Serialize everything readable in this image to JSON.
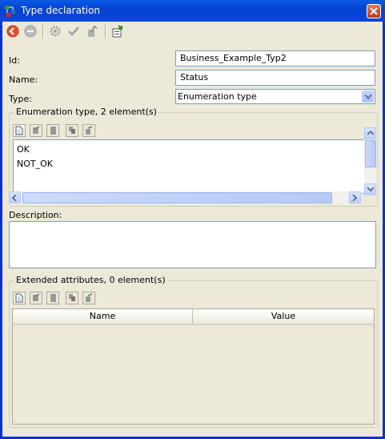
{
  "window": {
    "title": "Type declaration",
    "close_label": "×"
  },
  "toolbar": {
    "buttons": [
      {
        "name": "back-icon",
        "enabled": true
      },
      {
        "name": "stop-icon",
        "enabled": false
      },
      {
        "name": "settings-icon",
        "enabled": false
      },
      {
        "name": "check-icon",
        "enabled": false
      },
      {
        "name": "apply-icon",
        "enabled": false
      },
      {
        "name": "export-icon",
        "enabled": true
      }
    ]
  },
  "form": {
    "id_label": "Id:",
    "id_value": "Business_Example_Typ2",
    "name_label": "Name:",
    "name_value": "Status",
    "type_label": "Type:",
    "type_value": "Enumeration type",
    "description_label": "Description:",
    "description_value": ""
  },
  "enumeration": {
    "title": "Enumeration type, 2 element(s)",
    "items": [
      "OK",
      "NOT_OK"
    ]
  },
  "extended": {
    "title": "Extended attributes, 0 element(s)",
    "columns": [
      "Name",
      "Value"
    ]
  },
  "colors": {
    "titlebar": "#0a48d8",
    "dialog_bg": "#ece9d8",
    "field_border": "#7f9db9"
  }
}
